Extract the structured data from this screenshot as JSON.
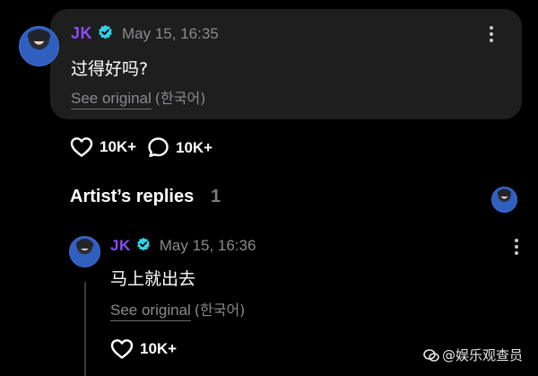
{
  "post": {
    "author": "JK",
    "timestamp": "May 15, 16:35",
    "text": "过得好吗?",
    "see_original": "See original",
    "language": "(한국어)",
    "likes": "10K+",
    "comments": "10K+"
  },
  "artist_replies": {
    "title": "Artist’s replies",
    "count": "1"
  },
  "reply": {
    "author": "JK",
    "timestamp": "May 15, 16:36",
    "text": "马上就出去",
    "see_original": "See original",
    "language": "(한국어)",
    "likes": "10K+"
  },
  "watermark": {
    "text": "@娱乐观查员"
  },
  "colors": {
    "background": "#000000",
    "card": "#1e1e1f",
    "author": "#8b4cf6",
    "verified": "#2dd4e8",
    "muted": "#8a8a8e"
  },
  "icons": {
    "verified": "verified-badge-icon",
    "more": "more-vertical-icon",
    "like": "heart-icon",
    "comment": "comment-bubble-icon"
  }
}
